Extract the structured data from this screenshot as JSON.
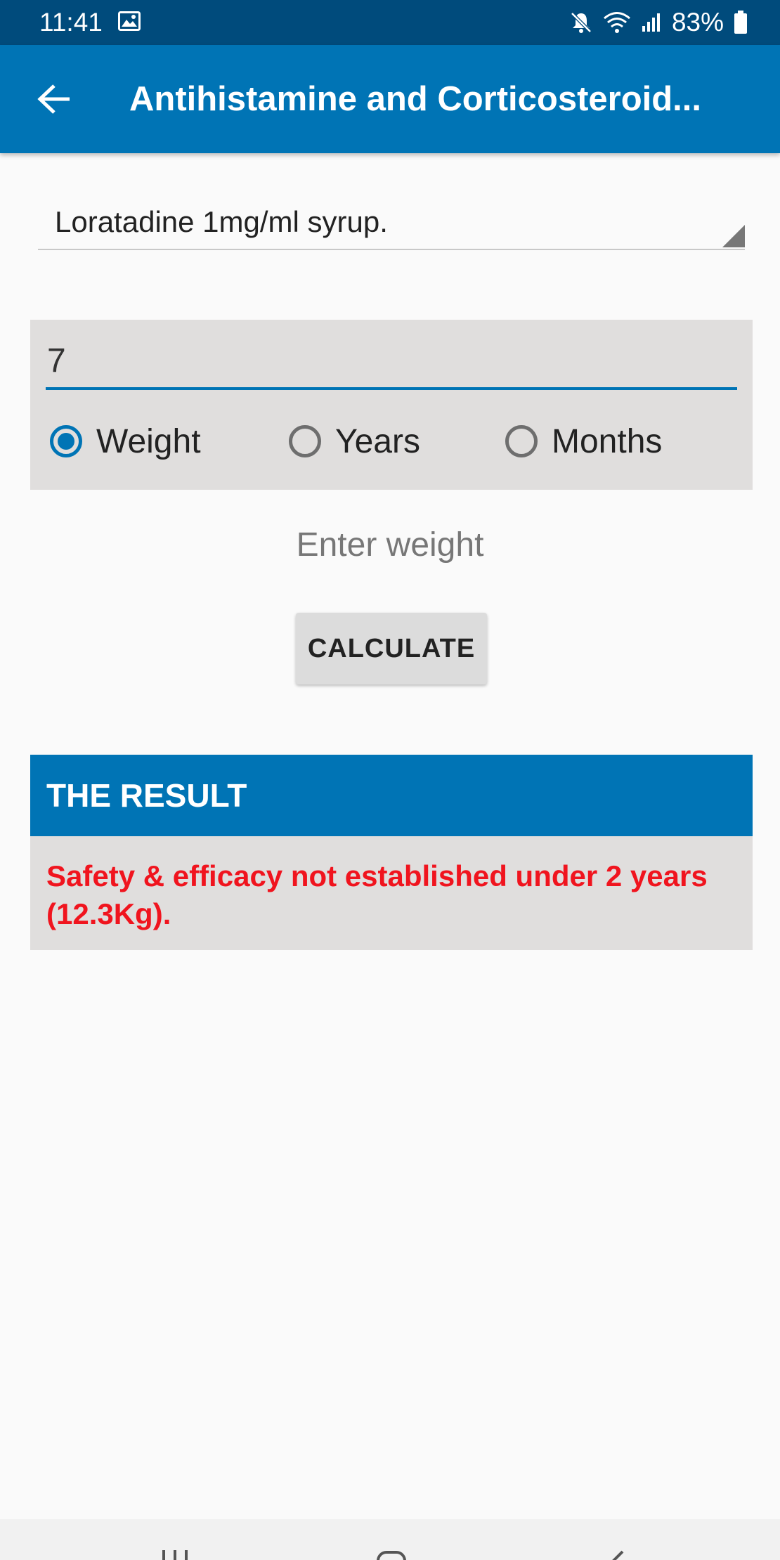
{
  "status_bar": {
    "time": "11:41",
    "battery": "83%",
    "icons": [
      "image-icon",
      "mute-icon",
      "wifi-icon",
      "signal-icon",
      "battery-icon"
    ]
  },
  "app_bar": {
    "title": "Antihistamine and Corticosteroid...",
    "back_icon": "arrow-left-icon"
  },
  "drug_select": {
    "selected": "Loratadine 1mg/ml syrup."
  },
  "dose_input": {
    "value": "7",
    "radio_options": [
      {
        "label": "Weight",
        "checked": true
      },
      {
        "label": "Years",
        "checked": false
      },
      {
        "label": "Months",
        "checked": false
      }
    ]
  },
  "hint": "Enter weight",
  "calculate_label": "CALCULATE",
  "result": {
    "header": "THE RESULT",
    "text": "Safety & efficacy not established under 2 years (12.3Kg)."
  },
  "colors": {
    "status_bar": "#004b7c",
    "primary": "#0074b5",
    "panel": "#e0dedd",
    "error_text": "#f0141e"
  },
  "nav_bar": {
    "icons": [
      "recents-icon",
      "home-icon",
      "back-icon"
    ]
  }
}
